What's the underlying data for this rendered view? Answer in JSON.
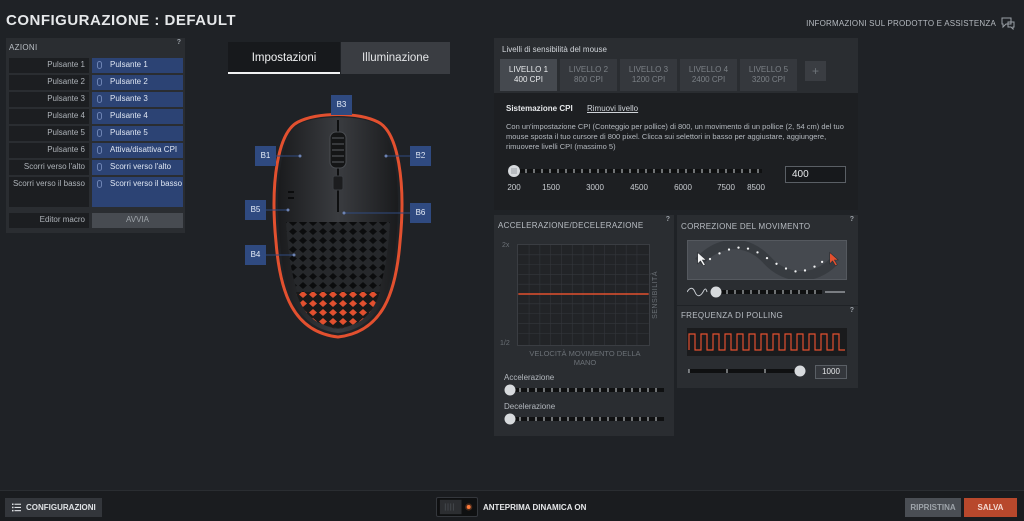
{
  "header": {
    "title": "CONFIGURAZIONE : DEFAULT",
    "info_link": "INFORMAZIONI SUL PRODOTTO E ASSISTENZA"
  },
  "actions": {
    "title": "AZIONI",
    "help": "?",
    "rows": [
      {
        "label": "Pulsante 1",
        "value": "Pulsante 1"
      },
      {
        "label": "Pulsante 2",
        "value": "Pulsante 2"
      },
      {
        "label": "Pulsante 3",
        "value": "Pulsante 3"
      },
      {
        "label": "Pulsante 4",
        "value": "Pulsante 4"
      },
      {
        "label": "Pulsante 5",
        "value": "Pulsante 5"
      },
      {
        "label": "Pulsante 6",
        "value": "Attiva/disattiva CPI"
      },
      {
        "label": "Scorri verso l'alto",
        "value": "Scorri verso l'alto"
      },
      {
        "label": "Scorri verso il basso",
        "value": "Scorri verso il basso"
      }
    ],
    "macro_label": "Editor macro",
    "macro_button": "AVVIA"
  },
  "tabs": [
    {
      "label": "Impostazioni",
      "active": true
    },
    {
      "label": "Illuminazione",
      "active": false
    }
  ],
  "mouse": {
    "badges": [
      "B1",
      "B2",
      "B3",
      "B4",
      "B5",
      "B6"
    ]
  },
  "cpi": {
    "title": "Livelli di sensibilità del mouse",
    "levels": [
      {
        "name": "LIVELLO 1",
        "cpi": "400 CPI",
        "active": true
      },
      {
        "name": "LIVELLO 2",
        "cpi": "800 CPI",
        "active": false
      },
      {
        "name": "LIVELLO 3",
        "cpi": "1200 CPI",
        "active": false
      },
      {
        "name": "LIVELLO 4",
        "cpi": "2400 CPI",
        "active": false
      },
      {
        "name": "LIVELLO 5",
        "cpi": "3200 CPI",
        "active": false
      }
    ],
    "add_level": "+",
    "section": "Sistemazione CPI",
    "remove_level": "Rimuovi livello",
    "description": "Con un'impostazione CPI (Conteggio per pollice) di 800, un movimento di un pollice (2, 54 cm) del tuo mouse sposta il tuo cursore di 800 pixel. Clicca sui selettori in basso per aggiustare, aggiungere, rimuovere livelli CPI (massimo 5)",
    "ticks": [
      "200",
      "1500",
      "3000",
      "4500",
      "6000",
      "7500",
      "8500"
    ],
    "value": "400",
    "slider_fraction": 0.0
  },
  "acceleration": {
    "title": "ACCELERAZIONE/DECELERAZIONE",
    "help": "?",
    "y_top": "2x",
    "y_bottom": "1/2",
    "y_axis": "SENSIBILITÀ",
    "x_axis": "VELOCITÀ MOVIMENTO DELLA MANO",
    "accel_label": "Accelerazione",
    "decel_label": "Decelerazione"
  },
  "correction": {
    "title": "CORREZIONE DEL MOVIMENTO",
    "help": "?"
  },
  "polling": {
    "title": "FREQUENZA DI POLLING",
    "help": "?",
    "value": "1000"
  },
  "footer": {
    "configurations": "CONFIGURAZIONI",
    "preview": "ANTEPRIMA DINAMICA ON",
    "reset": "RIPRISTINA",
    "save": "SALVA"
  },
  "colors": {
    "accent": "#e2502f",
    "button_blue": "#2c4374",
    "save": "#b8482c"
  }
}
